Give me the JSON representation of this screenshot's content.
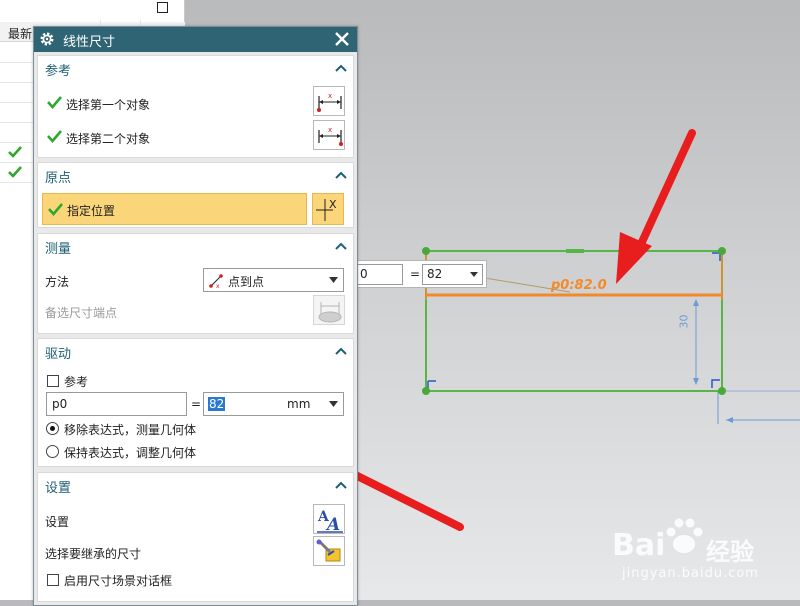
{
  "navigator": {
    "header_text": "最新",
    "rows": [
      true,
      true
    ]
  },
  "dialog": {
    "title": "线性尺寸",
    "reference": {
      "title": "参考",
      "first_object": "选择第一个对象",
      "second_object": "选择第二个对象"
    },
    "origin": {
      "title": "原点",
      "specify_location": "指定位置"
    },
    "measure": {
      "title": "测量",
      "method_label": "方法",
      "method_value": "点到点",
      "alt_endpoint_label": "备选尺寸端点"
    },
    "drive": {
      "title": "驱动",
      "reference_label": "参考",
      "reference_checked": false,
      "expression_name": "p0",
      "equals": "=",
      "value": "82",
      "unit": "mm",
      "options": [
        "移除表达式，测量几何体",
        "保持表达式，调整几何体"
      ],
      "selected_option": 0
    },
    "settings": {
      "title": "设置",
      "settings_label": "设置",
      "inherit_label": "选择要继承的尺寸",
      "dialog_checkbox_label": "启用尺寸场景对话框",
      "dialog_checkbox_checked": false
    }
  },
  "canvas": {
    "float_input": {
      "left_value": "0",
      "equals": "=",
      "right_value": "82"
    },
    "dimension_label": "p0:82.0",
    "vertical_dim_label": "30",
    "colors": {
      "sketch_line": "#58b547",
      "dimension_line": "#f28a2b",
      "dimension_blue": "#6d9bd1",
      "vertex": "#4aa83a",
      "arrow": "#e81e1e"
    }
  },
  "watermark": {
    "logo_text": "Bai",
    "logo_suffix": "经验",
    "url": "jingyan.baidu.com"
  }
}
